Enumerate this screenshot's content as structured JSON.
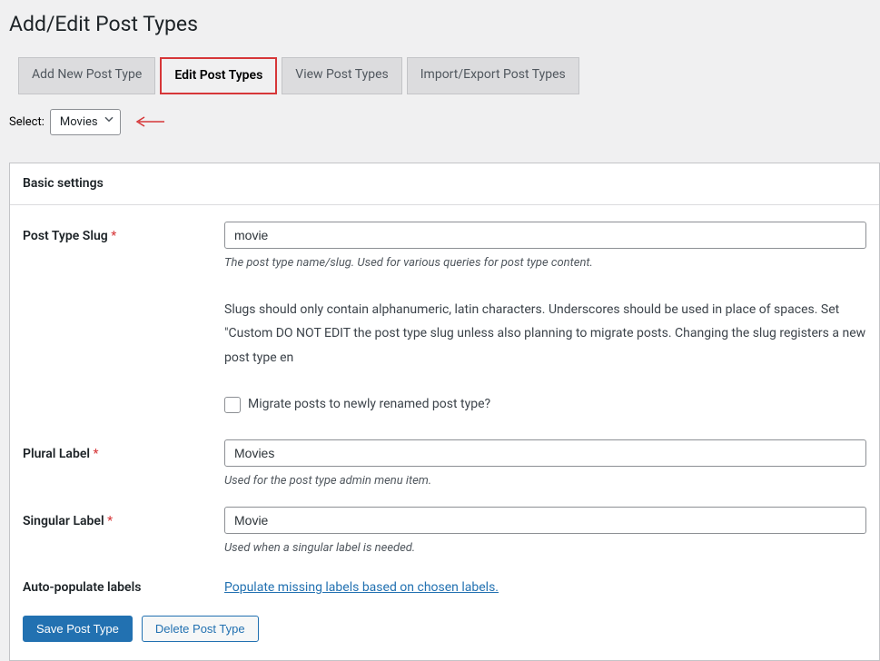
{
  "page_title": "Add/Edit Post Types",
  "tabs": {
    "add": "Add New Post Type",
    "edit": "Edit Post Types",
    "view": "View Post Types",
    "import": "Import/Export Post Types"
  },
  "select_label": "Select:",
  "select_value": "Movies",
  "panel_header": "Basic settings",
  "fields": {
    "slug": {
      "label": "Post Type Slug",
      "value": "movie",
      "desc": "The post type name/slug. Used for various queries for post type content.",
      "para": "Slugs should only contain alphanumeric, latin characters. Underscores should be used in place of spaces. Set \"Custom DO NOT EDIT the post type slug unless also planning to migrate posts. Changing the slug registers a new post type en",
      "migrate_label": "Migrate posts to newly renamed post type?"
    },
    "plural": {
      "label": "Plural Label",
      "value": "Movies",
      "desc": "Used for the post type admin menu item."
    },
    "singular": {
      "label": "Singular Label",
      "value": "Movie",
      "desc": "Used when a singular label is needed."
    },
    "autopop": {
      "label": "Auto-populate labels",
      "link": "Populate missing labels based on chosen labels."
    }
  },
  "buttons": {
    "save": "Save Post Type",
    "delete": "Delete Post Type"
  }
}
